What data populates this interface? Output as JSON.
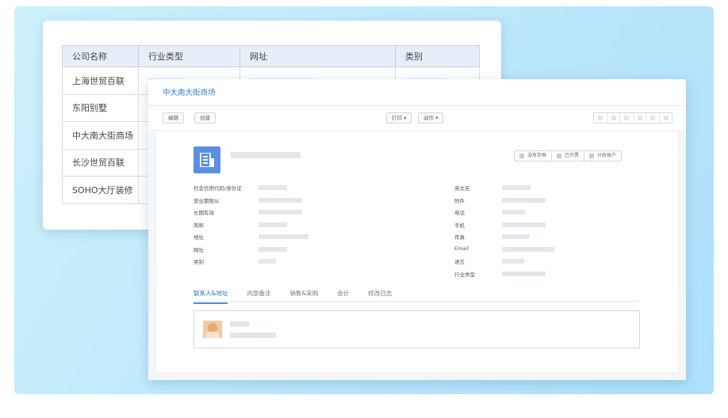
{
  "table": {
    "headers": [
      "公司名称",
      "行业类型",
      "网址",
      "类别"
    ],
    "rows": [
      {
        "name": "上海世贸百联"
      },
      {
        "name": "东阳别墅"
      },
      {
        "name": "中大南大街商场"
      },
      {
        "name": "长沙世贸百联"
      },
      {
        "name": "SOHO大厅装修"
      }
    ],
    "selected_index": 2
  },
  "detail": {
    "breadcrumb": "中大南大街商场",
    "toolbar": {
      "edit": "编辑",
      "create": "创建",
      "print": "打印",
      "action": "动作"
    },
    "stat_buttons": [
      "没有存档",
      "已开票",
      "分析账户"
    ],
    "left_fields": [
      "社会信用代码/身份证",
      "营业期限从",
      "长期有效",
      "简称",
      "地址",
      "网址",
      "类别"
    ],
    "right_fields": [
      "英文名",
      "附件",
      "电话",
      "手机",
      "传真",
      "Email",
      "语言",
      "行业类型"
    ],
    "tabs": [
      "联系人&地址",
      "内部备注",
      "销售&采购",
      "会计",
      "修改日志"
    ],
    "active_tab": 0
  },
  "colors": {
    "accent": "#2f7ed8",
    "icon_bg": "#5b8fe6",
    "background_gradient_start": "#cdf0fb",
    "background_gradient_end": "#aee0fb"
  },
  "icons": {
    "company": "building-card-icon",
    "print_caret": "chevron-down-icon",
    "action_caret": "chevron-down-icon"
  }
}
